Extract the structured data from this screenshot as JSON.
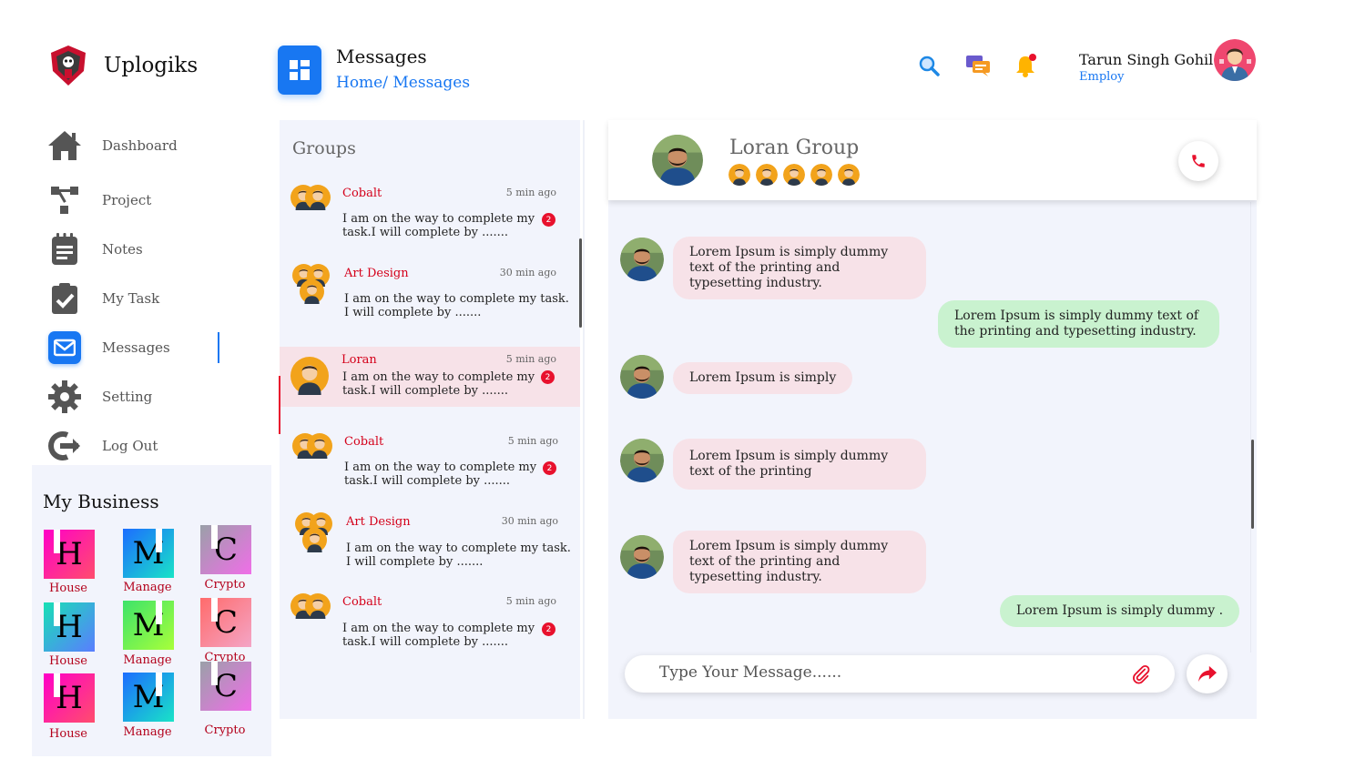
{
  "app": {
    "name": "Uplogiks"
  },
  "header": {
    "title": "Messages",
    "breadcrumb": "Home/ Messages"
  },
  "user": {
    "name": "Tarun Singh Gohil",
    "role": "Employ"
  },
  "sidebar": {
    "items": [
      {
        "label": "Dashboard",
        "icon": "home-icon"
      },
      {
        "label": "Project",
        "icon": "project-icon"
      },
      {
        "label": "Notes",
        "icon": "notes-icon"
      },
      {
        "label": "My Task",
        "icon": "task-icon"
      },
      {
        "label": "Messages",
        "icon": "mail-icon",
        "active": true
      },
      {
        "label": "Setting",
        "icon": "gear-icon"
      },
      {
        "label": "Log Out",
        "icon": "logout-icon"
      }
    ]
  },
  "business": {
    "title": "My Business",
    "tiles": [
      {
        "letter": "H",
        "label": "House"
      },
      {
        "letter": "M",
        "label": "Manage"
      },
      {
        "letter": "C",
        "label": "Crypto"
      },
      {
        "letter": "H",
        "label": "House"
      },
      {
        "letter": "M",
        "label": "Manage"
      },
      {
        "letter": "C",
        "label": "Crypto"
      },
      {
        "letter": "H",
        "label": "House"
      },
      {
        "letter": "M",
        "label": "Manage"
      },
      {
        "letter": "C",
        "label": "Crypto"
      }
    ]
  },
  "groups": {
    "title": "Groups",
    "items": [
      {
        "name": "Cobalt",
        "time": "5 min ago",
        "line1": "I am on the way to complete my",
        "line2": "task.I will complete by .......",
        "badge": "2"
      },
      {
        "name": "Art Design",
        "time": "30 min ago",
        "line1": "I am on the way to complete my task.",
        "line2": "I will complete by .......",
        "badge": ""
      },
      {
        "name": "Loran",
        "time": "5 min ago",
        "line1": "I am on the way to complete my",
        "line2": "task.I will complete by .......",
        "badge": "2",
        "selected": true
      },
      {
        "name": "Cobalt",
        "time": "5 min ago",
        "line1": "I am on the way to complete my",
        "line2": "task.I will complete by .......",
        "badge": "2"
      },
      {
        "name": "Art Design",
        "time": "30 min ago",
        "line1": "I am on the way to complete my task.",
        "line2": "I will complete by .......",
        "badge": ""
      },
      {
        "name": "Cobalt",
        "time": "5 min ago",
        "line1": "I am on the way to complete my",
        "line2": "task.I will complete by .......",
        "badge": "2"
      }
    ]
  },
  "chat": {
    "title": "Loran Group",
    "messages": [
      {
        "dir": "in",
        "text": "Lorem Ipsum is simply dummy text of the printing and typesetting industry."
      },
      {
        "dir": "out",
        "text": "Lorem Ipsum is simply dummy text of the printing and typesetting industry."
      },
      {
        "dir": "in",
        "text": "Lorem Ipsum is simply"
      },
      {
        "dir": "in",
        "text": "Lorem Ipsum is simply dummy text of the printing"
      },
      {
        "dir": "in",
        "text": "Lorem Ipsum is simply dummy text of the printing and typesetting industry."
      },
      {
        "dir": "out",
        "text": "Lorem Ipsum is simply dummy ."
      }
    ],
    "input_placeholder": "Type Your Message......"
  },
  "colors": {
    "accent": "#1877f2",
    "alert": "#e8112d",
    "incoming": "#f7e2e8",
    "outgoing": "#c9f2cf",
    "panel": "#f2f4fc"
  }
}
